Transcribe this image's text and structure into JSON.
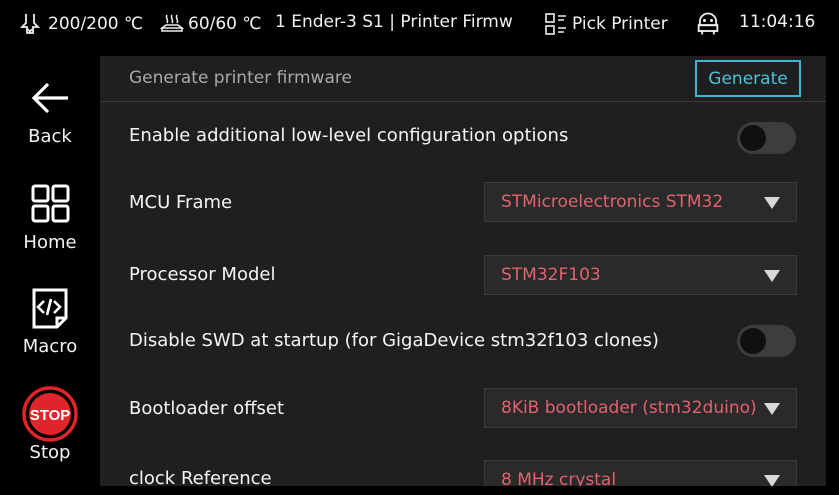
{
  "topbar": {
    "extruder_temp": "200/200 ℃",
    "bed_temp": "60/60 ℃",
    "printer_name": "1 Ender-3 S1 | Printer Firmw",
    "pick_printer": "Pick Printer",
    "time": "11:04:16",
    "icons": {
      "extruder": "extruder-icon",
      "bed": "heated-bed-icon",
      "pick": "pick-printer-icon",
      "robot": "robot-icon"
    }
  },
  "nav": {
    "back": "Back",
    "home": "Home",
    "macro": "Macro",
    "stop": "Stop",
    "stop_badge": "STOP"
  },
  "panel": {
    "title": "Generate printer firmware",
    "generate": "Generate",
    "rows": {
      "lowlevel": {
        "label": "Enable additional low-level configuration options",
        "enabled": false
      },
      "mcu": {
        "label": "MCU Frame",
        "value": "STMicroelectronics STM32"
      },
      "processor": {
        "label": "Processor Model",
        "value": "STM32F103"
      },
      "swd": {
        "label": "Disable SWD at startup (for GigaDevice stm32f103 clones)",
        "enabled": false
      },
      "bootloader": {
        "label": "Bootloader offset",
        "value": "8KiB bootloader (stm32duino)"
      },
      "clock": {
        "label": "clock Reference",
        "value": "8 MHz crystal"
      }
    }
  },
  "colors": {
    "accent": "#47c3dd",
    "value_text": "#e0636f",
    "stop_red": "#e0242c",
    "panel_bg": "#1f1f1f"
  }
}
